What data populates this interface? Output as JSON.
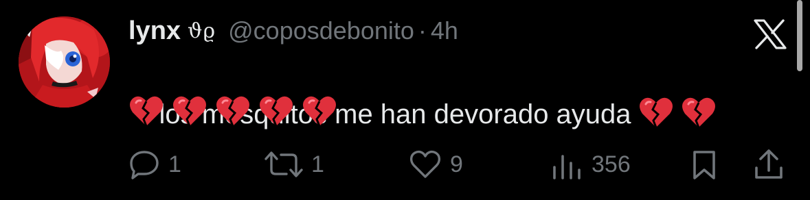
{
  "tweet": {
    "display_name": "lynx",
    "name_glyphs": "ϑϱ",
    "handle": "@coposdebonito",
    "separator": "·",
    "time": "4h",
    "text": "los mosquitos me han devorado ayuda",
    "emoji": "💔",
    "emoji_line1_count": 2,
    "emoji_line2_count": 5
  },
  "actions": {
    "replies": "1",
    "reposts": "1",
    "likes": "9",
    "views": "356"
  },
  "icons": {
    "platform": "x-logo-icon",
    "reply": "reply-icon",
    "repost": "repost-icon",
    "like": "heart-icon",
    "views": "views-icon",
    "bookmark": "bookmark-icon",
    "share": "share-icon"
  },
  "colors": {
    "background": "#000000",
    "primary_text": "#e7e9ea",
    "secondary_text": "#71767b",
    "heart": "#e0303c"
  }
}
